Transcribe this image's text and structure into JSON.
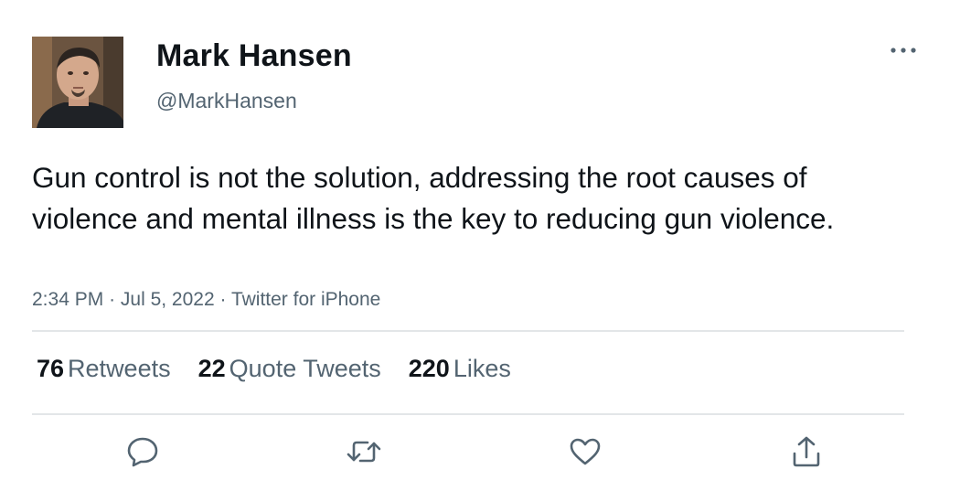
{
  "author": {
    "display_name": "Mark Hansen",
    "handle": "@MarkHansen",
    "avatar_icon": "profile-photo"
  },
  "tweet": {
    "text": "Gun control is not the solution, addressing the root causes of violence and mental illness is the key to reducing gun violence.",
    "time": "2:34 PM",
    "date": "Jul 5, 2022",
    "source": "Twitter for iPhone",
    "separator": "·"
  },
  "stats": {
    "retweets_count": "76",
    "retweets_label": "Retweets",
    "quotes_count": "22",
    "quotes_label": "Quote Tweets",
    "likes_count": "220",
    "likes_label": "Likes"
  },
  "actions": {
    "reply_icon": "reply-icon",
    "retweet_icon": "retweet-icon",
    "like_icon": "heart-icon",
    "share_icon": "share-icon",
    "more_icon": "more-horizontal-icon"
  },
  "colors": {
    "text_primary": "#0f1419",
    "text_secondary": "#536471",
    "divider": "#e3e6e8",
    "icon": "#536471"
  }
}
